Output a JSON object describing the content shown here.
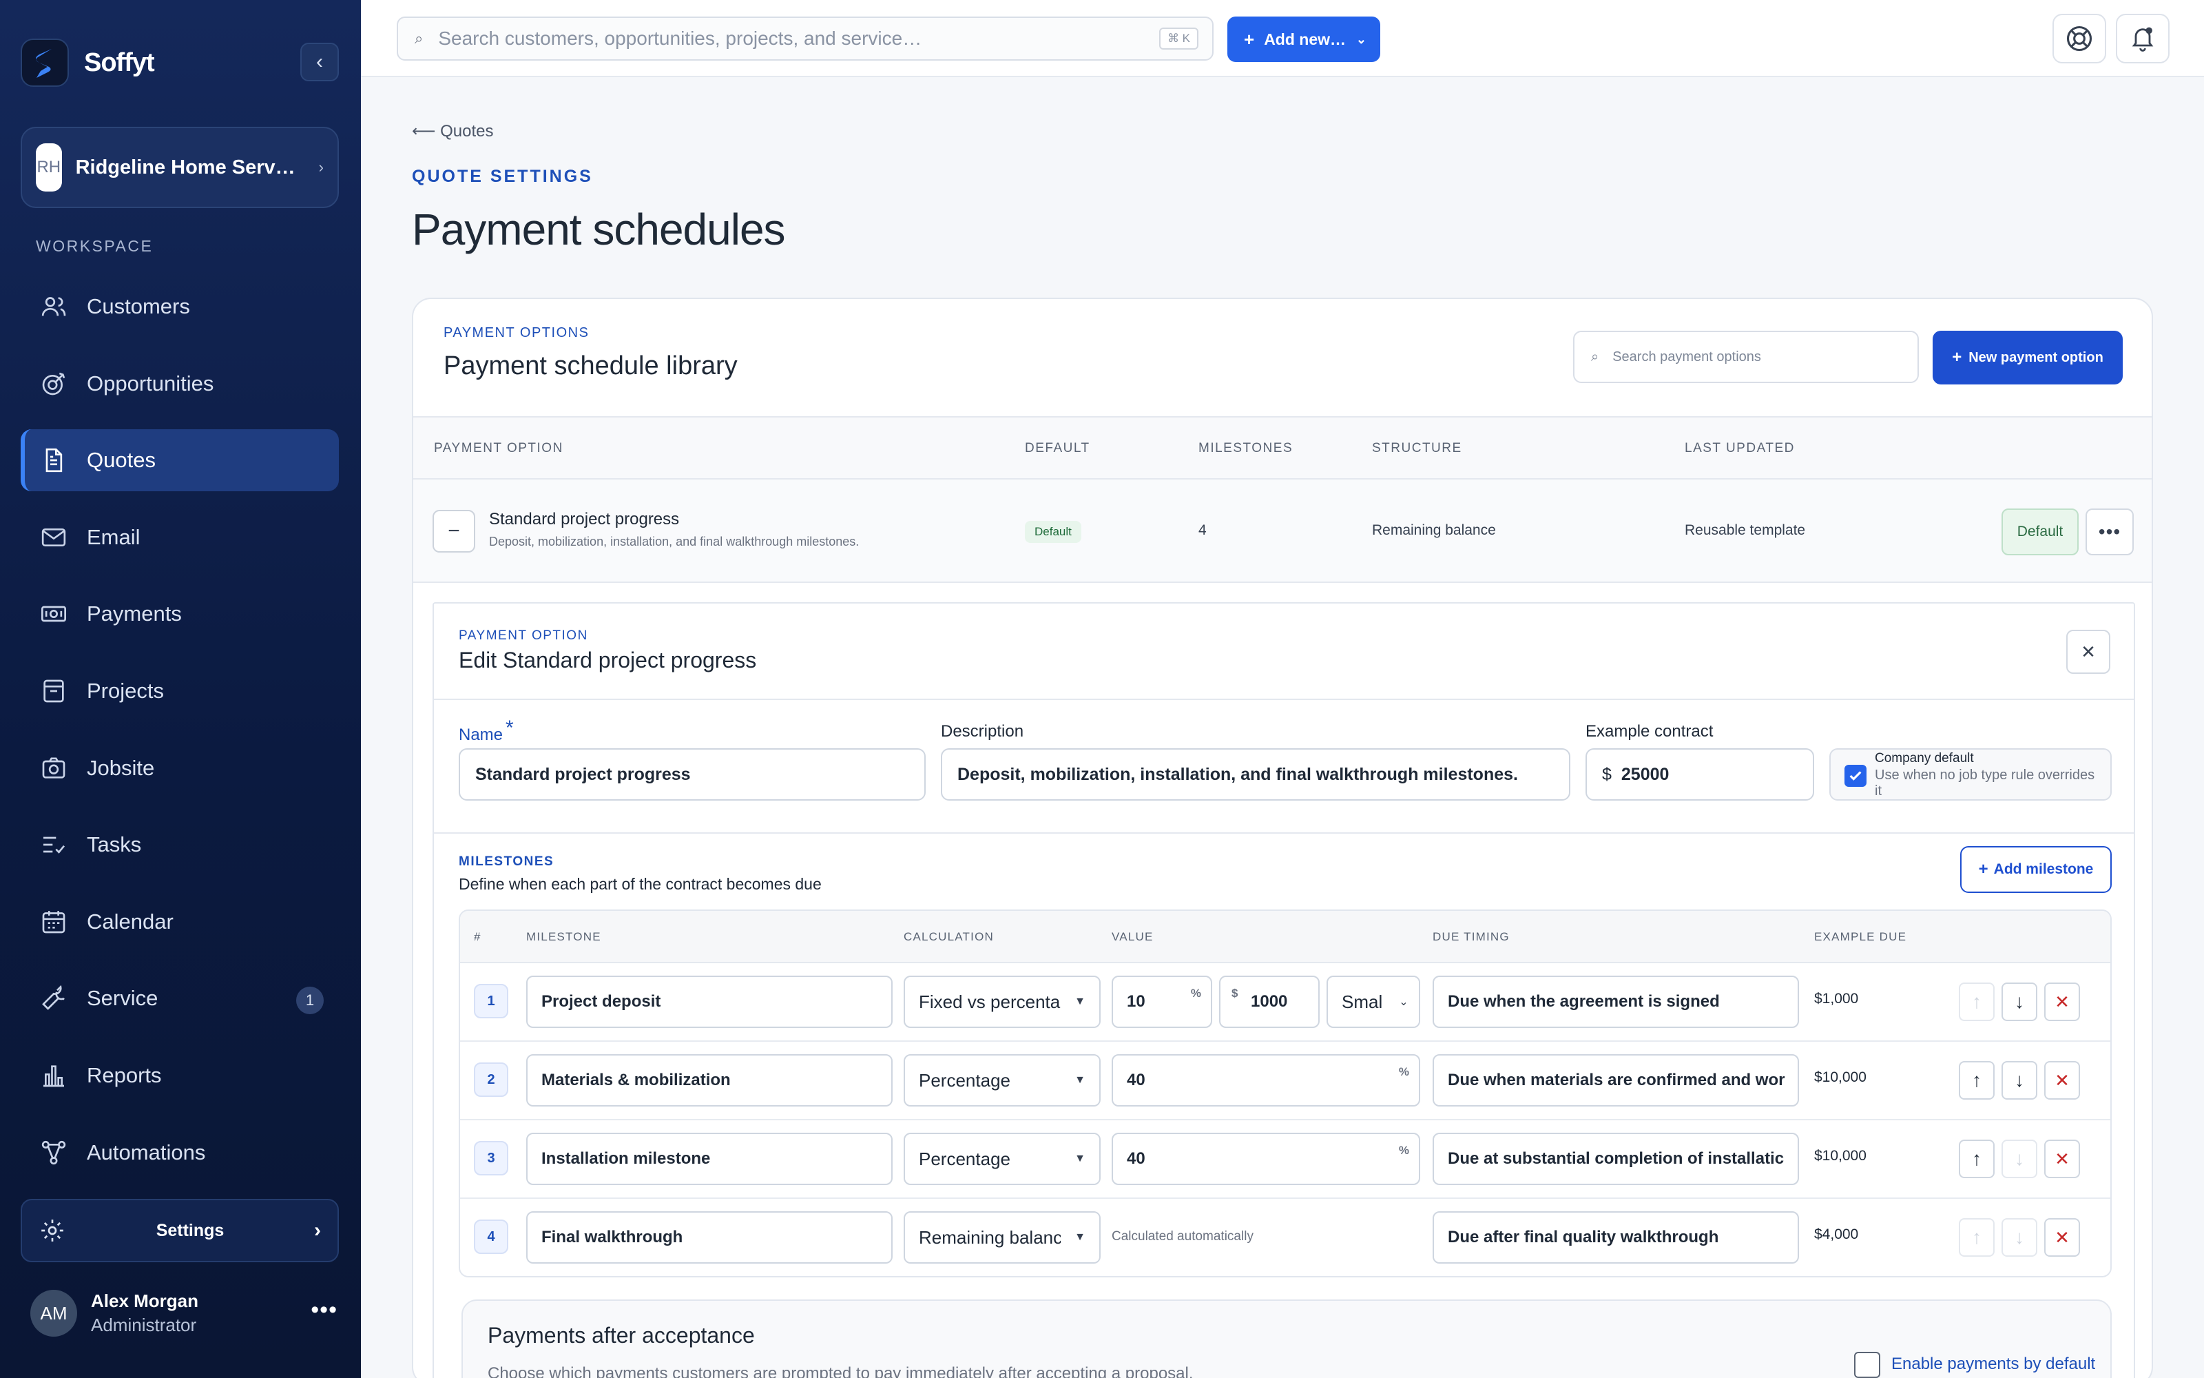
{
  "app": {
    "name": "Soffyt",
    "brand_color": "#2563eb"
  },
  "org": {
    "initials": "RH",
    "name": "Ridgeline Home Serv…"
  },
  "sidebar": {
    "section_label": "WORKSPACE",
    "items": [
      {
        "label": "Customers",
        "icon": "users-icon"
      },
      {
        "label": "Opportunities",
        "icon": "target-icon"
      },
      {
        "label": "Quotes",
        "icon": "document-icon",
        "active": true
      },
      {
        "label": "Email",
        "icon": "mail-icon"
      },
      {
        "label": "Payments",
        "icon": "cash-icon"
      },
      {
        "label": "Projects",
        "icon": "archive-icon"
      },
      {
        "label": "Jobsite",
        "icon": "camera-icon"
      },
      {
        "label": "Tasks",
        "icon": "checklist-icon"
      },
      {
        "label": "Calendar",
        "icon": "calendar-icon"
      },
      {
        "label": "Service",
        "icon": "wrench-icon",
        "badge": "1"
      },
      {
        "label": "Reports",
        "icon": "bar-chart-icon"
      },
      {
        "label": "Automations",
        "icon": "workflow-icon"
      }
    ],
    "settings_label": "Settings"
  },
  "user": {
    "initials": "AM",
    "name": "Alex Morgan",
    "role": "Administrator"
  },
  "topbar": {
    "search_placeholder": "Search customers, opportunities, projects, and service…",
    "shortcut": "⌘ K",
    "add_new_label": "Add new…"
  },
  "page": {
    "back_label": "Quotes",
    "eyebrow": "QUOTE SETTINGS",
    "title": "Payment schedules"
  },
  "library": {
    "eyebrow": "PAYMENT OPTIONS",
    "title": "Payment schedule library",
    "search_placeholder": "Search payment options",
    "new_button": "New payment option",
    "columns": [
      "PAYMENT OPTION",
      "DEFAULT",
      "MILESTONES",
      "STRUCTURE",
      "LAST UPDATED"
    ],
    "row": {
      "name": "Standard project progress",
      "description": "Deposit, mobilization, installation, and final walkthrough milestones.",
      "default_badge": "Default",
      "milestones": "4",
      "structure": "Remaining balance",
      "last_updated": "Reusable template",
      "default_button": "Default"
    }
  },
  "editor": {
    "eyebrow": "PAYMENT OPTION",
    "title": "Edit Standard project progress",
    "name_label": "Name",
    "required_mark": "*",
    "name_value": "Standard project progress",
    "description_label": "Description",
    "description_value": "Deposit, mobilization, installation, and final walkthrough milestones.",
    "example_label": "Example contract",
    "currency": "$",
    "example_value": "25000",
    "company_default_title": "Company default",
    "company_default_sub": "Use when no job type rule overrides it",
    "company_default_checked": true
  },
  "milestones": {
    "eyebrow": "MILESTONES",
    "subtitle": "Define when each part of the contract becomes due",
    "add_button": "Add milestone",
    "columns": [
      "#",
      "MILESTONE",
      "CALCULATION",
      "VALUE",
      "DUE TIMING",
      "EXAMPLE DUE"
    ],
    "percent_unit": "%",
    "dollar_unit": "$",
    "rows": [
      {
        "num": "1",
        "name": "Project deposit",
        "calc": "Fixed vs percenta",
        "value": "10",
        "amount": "1000",
        "rule": "Smal",
        "due": "Due when the agreement is signed",
        "example": "$1,000"
      },
      {
        "num": "2",
        "name": "Materials & mobilization",
        "calc": "Percentage",
        "value": "40",
        "due": "Due when materials are confirmed and wor",
        "example": "$10,000"
      },
      {
        "num": "3",
        "name": "Installation milestone",
        "calc": "Percentage",
        "value": "40",
        "due": "Due at substantial completion of installatic",
        "example": "$10,000"
      },
      {
        "num": "4",
        "name": "Final walkthrough",
        "calc": "Remaining balanc",
        "value": "Calculated automatically",
        "due": "Due after final quality walkthrough",
        "example": "$4,000"
      }
    ]
  },
  "after_acceptance": {
    "title": "Payments after acceptance",
    "subtitle": "Choose which payments customers are prompted to pay immediately after accepting a proposal.",
    "toggle_label": "Enable payments by default"
  }
}
